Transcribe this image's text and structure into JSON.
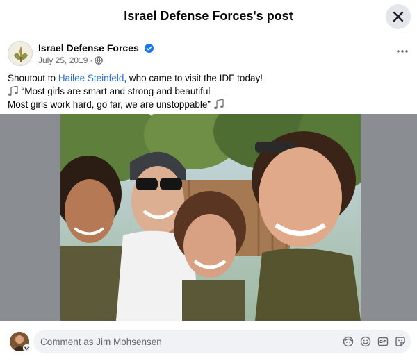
{
  "header": {
    "title": "Israel Defense Forces's post"
  },
  "post": {
    "page_name": "Israel Defense Forces",
    "date": "July 25, 2019",
    "separator": "·",
    "text": {
      "line1_prefix": "Shoutout to ",
      "mention": "Hailee Steinfeld",
      "line1_suffix": ", who came to visit the IDF today!",
      "line2": " “Most girls are smart and strong and beautiful",
      "line3": "Most girls work hard, go far, we are unstoppable” "
    },
    "photo_alt": "Selfie of four smiling women"
  },
  "comment": {
    "placeholder": "Comment as Jim Mohsensen"
  },
  "icons": [
    "close-icon",
    "verified-icon",
    "globe-icon",
    "more-icon",
    "music-note-icon",
    "avatar-icon",
    "sticker-icon",
    "emoji-icon",
    "gif-icon",
    "camera-icon"
  ],
  "colors": {
    "link": "#216fdb",
    "verified": "#1877f2",
    "secondary_text": "#65676b",
    "input_bg": "#f0f2f5"
  }
}
